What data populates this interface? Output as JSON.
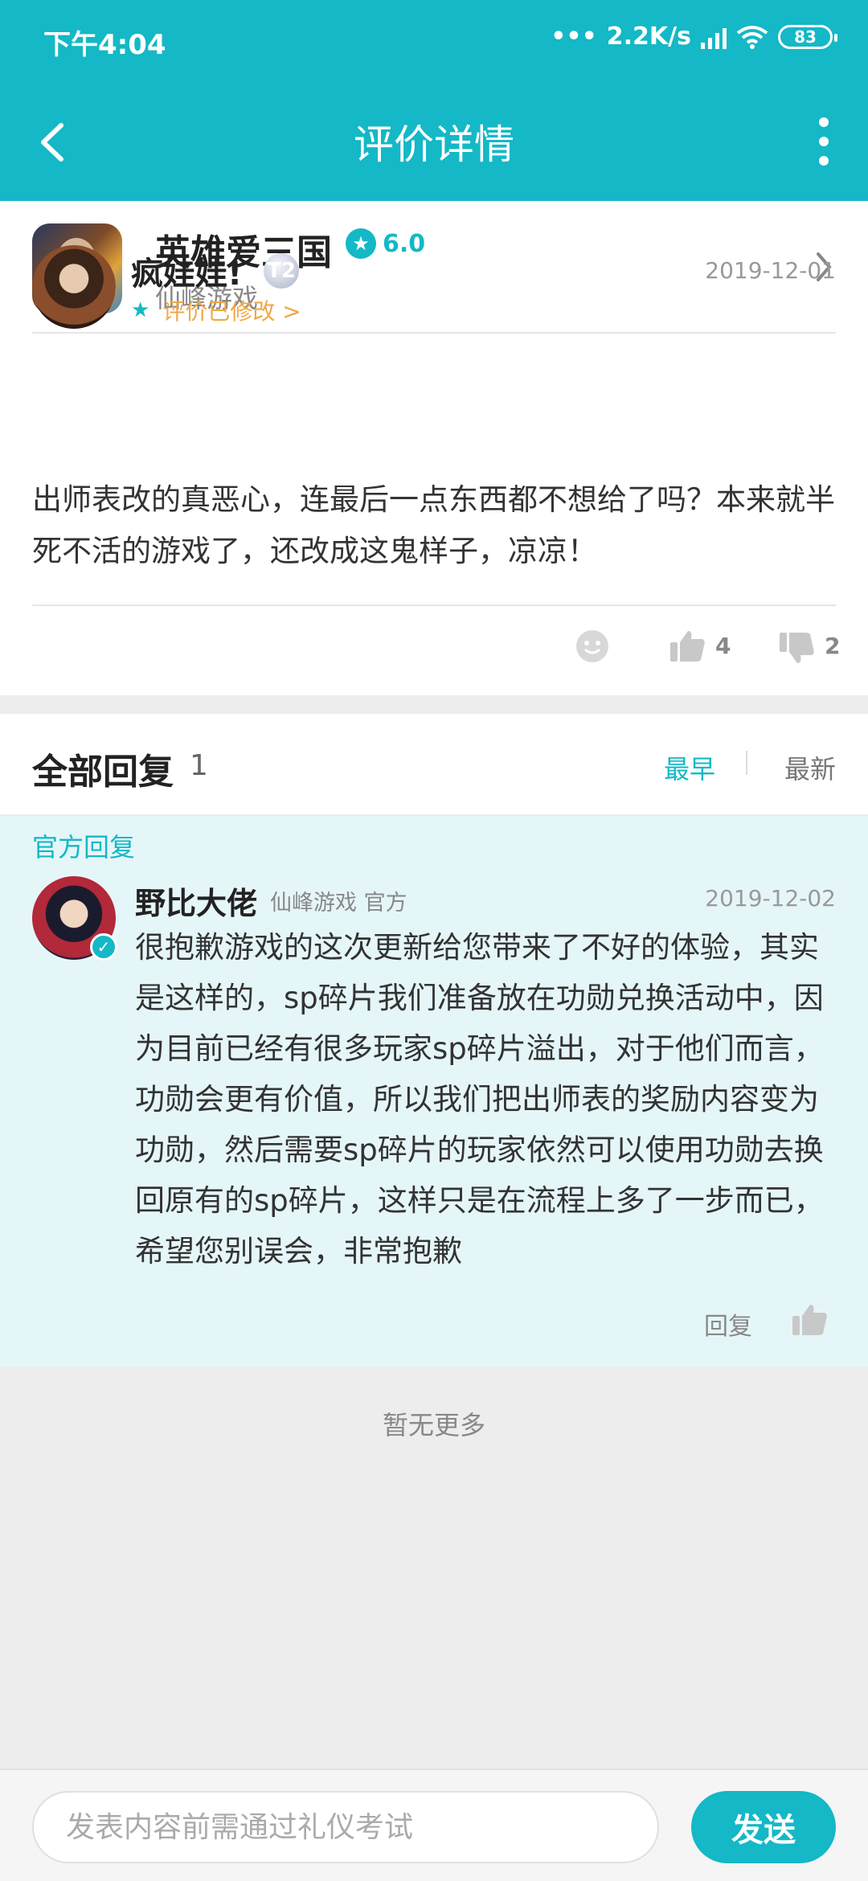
{
  "status_bar": {
    "time": "下午4:04",
    "network_speed": "2.2K/s",
    "battery": "83"
  },
  "header": {
    "title": "评价详情"
  },
  "game": {
    "name": "英雄爱三国",
    "rating": "6.0",
    "developer": "仙峰游戏"
  },
  "review": {
    "user": "疯娃娃!",
    "level": "T2",
    "date": "2019-12-01",
    "edited_label": "评价已修改 >",
    "text": "出师表改的真恶心，连最后一点东西都不想给了吗？本来就半死不活的游戏了，还改成这鬼样子，凉凉！",
    "likes": "4",
    "dislikes": "2"
  },
  "replies": {
    "title": "全部回复",
    "count": "1",
    "sort_earliest": "最早",
    "sort_latest": "最新"
  },
  "official_reply": {
    "label": "官方回复",
    "user": "野比大佬",
    "tag": "仙峰游戏 官方",
    "date": "2019-12-02",
    "text": "很抱歉游戏的这次更新给您带来了不好的体验，其实是这样的，sp碎片我们准备放在功勋兑换活动中，因为目前已经有很多玩家sp碎片溢出，对于他们而言，功勋会更有价值，所以我们把出师表的奖励内容变为功勋，然后需要sp碎片的玩家依然可以使用功勋去换回原有的sp碎片，这样只是在流程上多了一步而已，希望您别误会，非常抱歉",
    "reply_label": "回复"
  },
  "footer": {
    "no_more": "暂无更多"
  },
  "composer": {
    "placeholder": "发表内容前需通过礼仪考试",
    "send_label": "发送"
  },
  "colors": {
    "accent": "#14b8c6",
    "edited": "#f0a844",
    "official_bg": "#e5f6f9"
  },
  "icons": [
    "back-icon",
    "more-icon",
    "star-icon",
    "chevron-right-icon",
    "smile-icon",
    "like-icon",
    "dislike-icon",
    "verified-icon"
  ]
}
